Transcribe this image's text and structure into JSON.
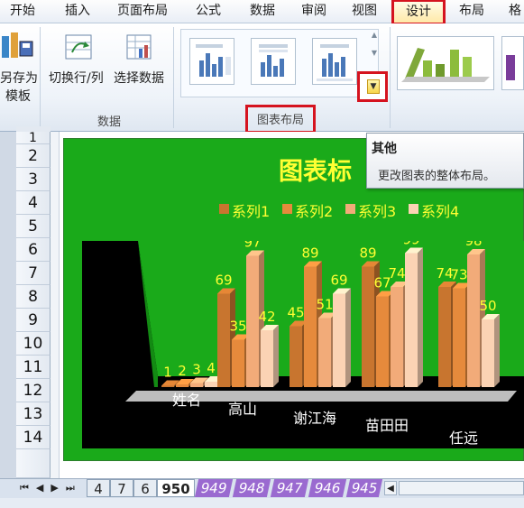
{
  "ribbon_tabs": [
    {
      "label": "开始",
      "selected": false
    },
    {
      "label": "插入",
      "selected": false
    },
    {
      "label": "页面布局",
      "selected": false
    },
    {
      "label": "公式",
      "selected": false
    },
    {
      "label": "数据",
      "selected": false
    },
    {
      "label": "审阅",
      "selected": false
    },
    {
      "label": "视图",
      "selected": false
    },
    {
      "label": "设计",
      "selected": true
    },
    {
      "label": "布局",
      "selected": false
    },
    {
      "label": "格",
      "selected": false
    }
  ],
  "ribbon": {
    "save_template_line1": "另存为",
    "save_template_line2": "模板",
    "switch_rowcol_label": "切换行/列",
    "select_data_label": "选择数据",
    "data_group_label": "数据",
    "chart_layouts_group_label": "图表布局"
  },
  "tooltip": {
    "title": "其他",
    "description": "更改图表的整体布局。"
  },
  "row_numbers": [
    "1",
    "2",
    "3",
    "4",
    "5",
    "6",
    "7",
    "8",
    "9",
    "10",
    "11",
    "12",
    "13",
    "14"
  ],
  "chart_data": {
    "type": "bar",
    "title": "图表标",
    "categories": [
      "姓名",
      "高山",
      "谢江海",
      "苗田田",
      "任远"
    ],
    "series": [
      {
        "name": "系列1",
        "values": [
          1,
          69,
          45,
          89,
          74
        ],
        "color": "#c8752f"
      },
      {
        "name": "系列2",
        "values": [
          2,
          35,
          89,
          67,
          73
        ],
        "color": "#e68a3c"
      },
      {
        "name": "系列3",
        "values": [
          3,
          97,
          51,
          74,
          98
        ],
        "color": "#f2ab79"
      },
      {
        "name": "系列4",
        "values": [
          4,
          42,
          69,
          99,
          50
        ],
        "color": "#fbd3b4"
      }
    ],
    "legend_position": "top",
    "chart_background": "#1aaa1a",
    "plot_background": "#000000",
    "label_color": "#ffff33"
  },
  "sheet_tabs": [
    {
      "label": "4",
      "active": false
    },
    {
      "label": "7",
      "active": false
    },
    {
      "label": "6",
      "active": false
    },
    {
      "label": "950",
      "active": true
    },
    {
      "label": "949",
      "active": false
    },
    {
      "label": "948",
      "active": false
    },
    {
      "label": "947",
      "active": false
    },
    {
      "label": "946",
      "active": false
    },
    {
      "label": "945",
      "active": false
    }
  ]
}
